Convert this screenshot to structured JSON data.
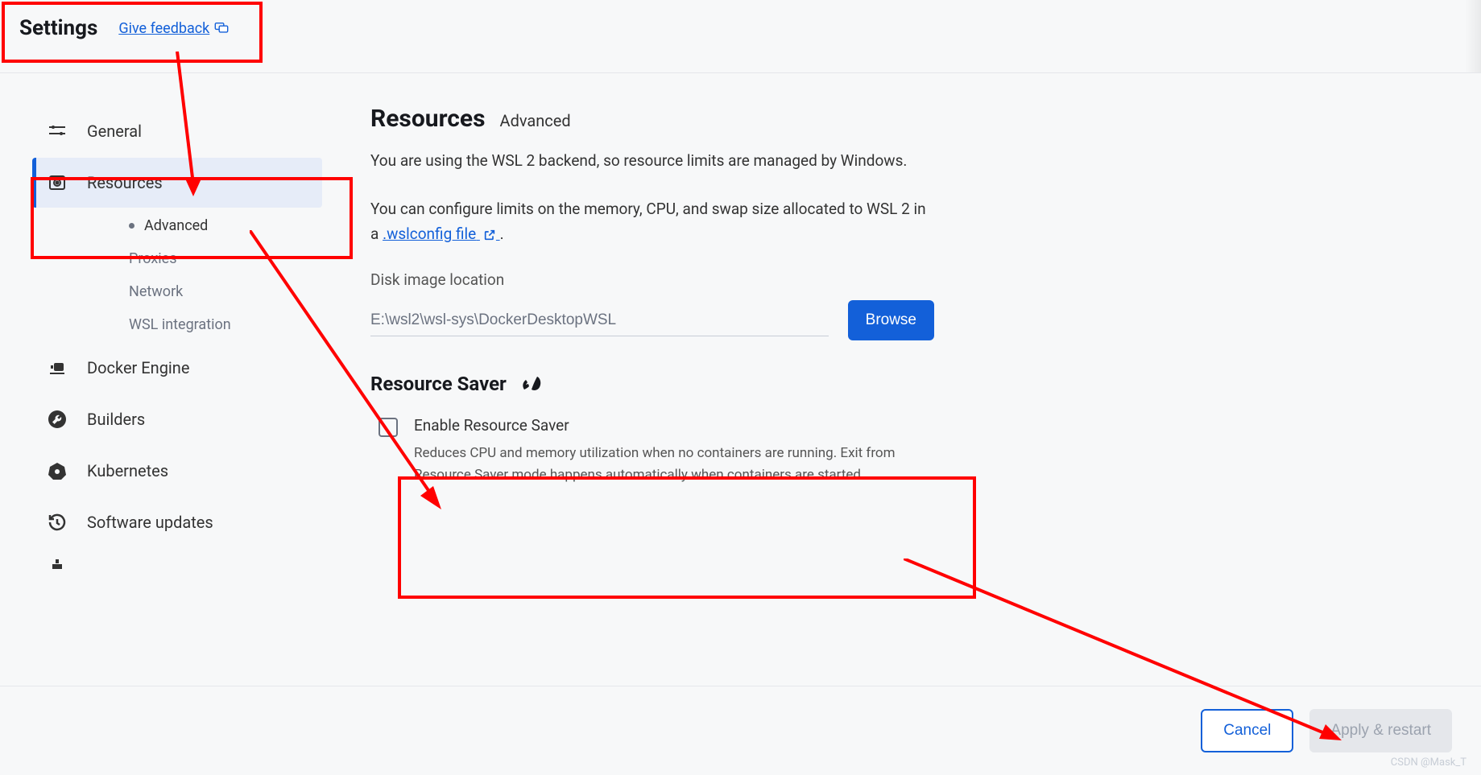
{
  "header": {
    "title": "Settings",
    "feedback_label": "Give feedback"
  },
  "sidebar": {
    "items": [
      {
        "label": "General"
      },
      {
        "label": "Resources",
        "children": [
          {
            "label": "Advanced",
            "active": true
          },
          {
            "label": "Proxies"
          },
          {
            "label": "Network"
          },
          {
            "label": "WSL integration"
          }
        ]
      },
      {
        "label": "Docker Engine"
      },
      {
        "label": "Builders"
      },
      {
        "label": "Kubernetes"
      },
      {
        "label": "Software updates"
      }
    ]
  },
  "main": {
    "title": "Resources",
    "subtitle": "Advanced",
    "desc1": "You are using the WSL 2 backend, so resource limits are managed by Windows.",
    "desc2_pre": "You can configure limits on the memory, CPU, and swap size allocated to WSL 2 in a ",
    "desc2_link": ".wslconfig file",
    "disk_label": "Disk image location",
    "disk_value": "E:\\wsl2\\wsl-sys\\DockerDesktopWSL",
    "browse_label": "Browse",
    "saver_title": "Resource Saver",
    "saver_checkbox_label": "Enable Resource Saver",
    "saver_checkbox_desc": "Reduces CPU and memory utilization when no containers are running. Exit from Resource Saver mode happens automatically when containers are started."
  },
  "footer": {
    "cancel": "Cancel",
    "apply": "Apply & restart"
  },
  "watermark": "CSDN @Mask_T"
}
